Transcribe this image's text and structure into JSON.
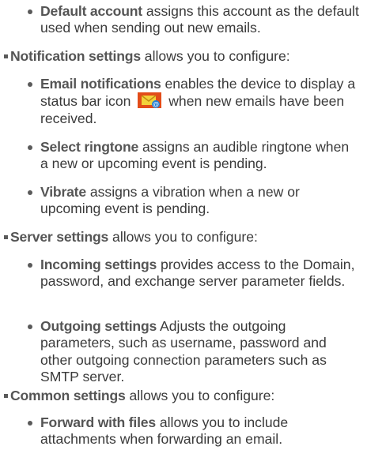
{
  "items": [
    {
      "level": "sub",
      "term": "Default account",
      "desc": " assigns this account as the default used when sending out new emails."
    },
    {
      "level": "top",
      "term": "Notification settings",
      "desc": " allows you to configure:"
    },
    {
      "level": "sub",
      "term": "Email notifications",
      "desc_before": " enables the device to display a status bar icon",
      "icon": "email-notification-icon",
      "desc_after": " when new emails have been received."
    },
    {
      "level": "sub",
      "term": "Select ringtone",
      "desc": " assigns an audible ringtone when a new or upcoming event is pending."
    },
    {
      "level": "sub",
      "term": "Vibrate",
      "desc": " assigns a vibration when a new or upcoming event is pending."
    },
    {
      "level": "top",
      "term": "Server settings",
      "desc": " allows you to configure:"
    },
    {
      "level": "sub",
      "term": "Incoming settings",
      "desc": " provides access to the Domain, password, and exchange server parameter fields."
    },
    {
      "level": "sub",
      "term": "Outgoing settings",
      "desc": " Adjusts the outgoing parameters, such as username, password and other outgoing connection parameters such as SMTP server."
    },
    {
      "level": "top",
      "term": "Common settings",
      "desc": " allows you to configure:"
    },
    {
      "level": "sub",
      "term": "Forward with files",
      "desc": " allows you to include attachments when forwarding an email."
    }
  ],
  "colors": {
    "icon_background": "#e24c19",
    "icon_envelope": "#f2d23a",
    "icon_badge": "#1f7fd6"
  }
}
